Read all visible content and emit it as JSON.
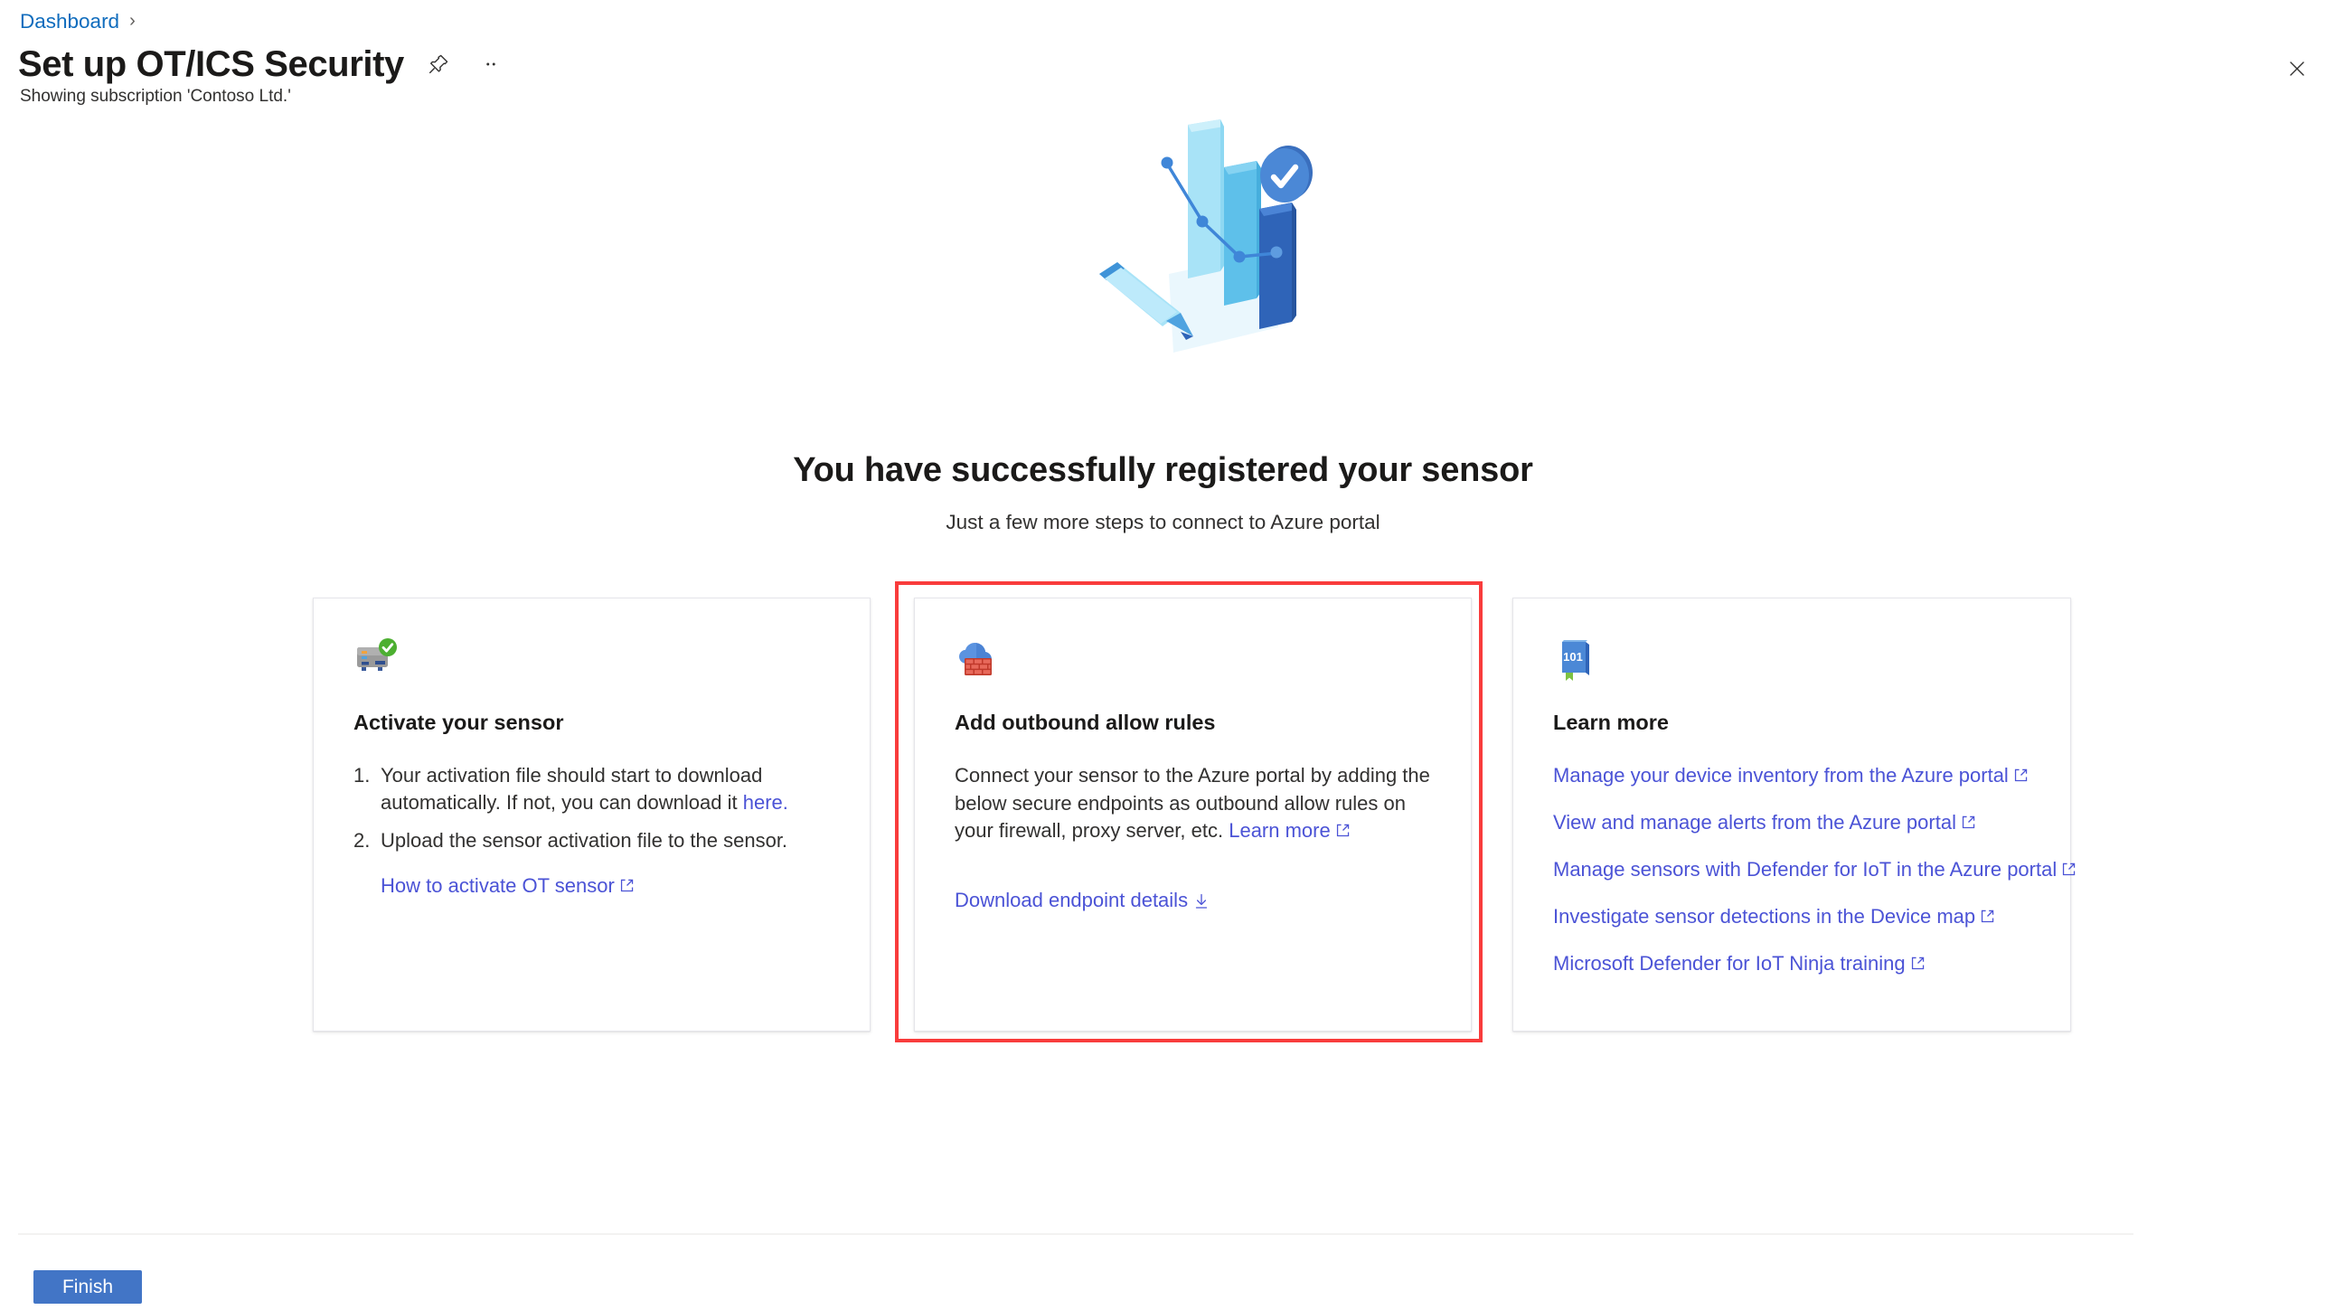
{
  "header": {
    "breadcrumb": {
      "items": [
        "Dashboard"
      ],
      "separator": "›"
    },
    "title": "Set up OT/ICS Security",
    "subtitle": "Showing subscription 'Contoso Ltd.'",
    "pin_icon": "pin-icon",
    "more_icon": "ellipsis-icon",
    "close_icon": "close-icon"
  },
  "hero": {
    "icon": "chart-pencil-check-illustration"
  },
  "main": {
    "heading": "You have successfully registered your sensor",
    "subheading": "Just a few more steps to connect to Azure portal"
  },
  "cards": [
    {
      "icon": "sensor-check-icon",
      "title": "Activate your sensor",
      "steps": [
        {
          "num": "1.",
          "text_before": "Your activation file should start to download automatically. If not, you can download it ",
          "link": "here."
        },
        {
          "num": "2.",
          "text_before": "Upload the sensor activation file to the sensor.",
          "link": ""
        }
      ],
      "link": {
        "label": "How to activate OT sensor",
        "icon": "external-link-icon"
      }
    },
    {
      "icon": "cloud-firewall-icon",
      "title": "Add outbound allow rules",
      "body_before": "Connect your sensor to the Azure portal by adding the below secure endpoints as outbound allow rules on your firewall, proxy server, etc. ",
      "body_link": "Learn more",
      "body_link_icon": "external-link-icon",
      "link": {
        "label": "Download endpoint details",
        "icon": "download-icon"
      },
      "highlighted": true,
      "highlight_color": "#f93c3c"
    },
    {
      "icon": "book-101-icon",
      "title": "Learn more",
      "links": [
        {
          "label": "Manage your device inventory from the Azure portal",
          "icon": "external-link-icon"
        },
        {
          "label": "View and manage alerts from the Azure portal",
          "icon": "external-link-icon"
        },
        {
          "label": "Manage sensors with Defender for IoT in the Azure portal",
          "icon": "external-link-icon"
        },
        {
          "label": "Investigate sensor detections in the Device map",
          "icon": "external-link-icon"
        },
        {
          "label": "Microsoft Defender for IoT Ninja training",
          "icon": "external-link-icon"
        }
      ]
    }
  ],
  "footer": {
    "finish_label": "Finish",
    "finish_color": "#4275c6"
  },
  "colors": {
    "link": "#4b53d6",
    "breadcrumb_link": "#0f6cbd",
    "title": "#1b1a19",
    "body": "#323130",
    "highlight": "#f93c3c",
    "primary_button": "#4275c6",
    "card_border": "#e5e5ea"
  }
}
